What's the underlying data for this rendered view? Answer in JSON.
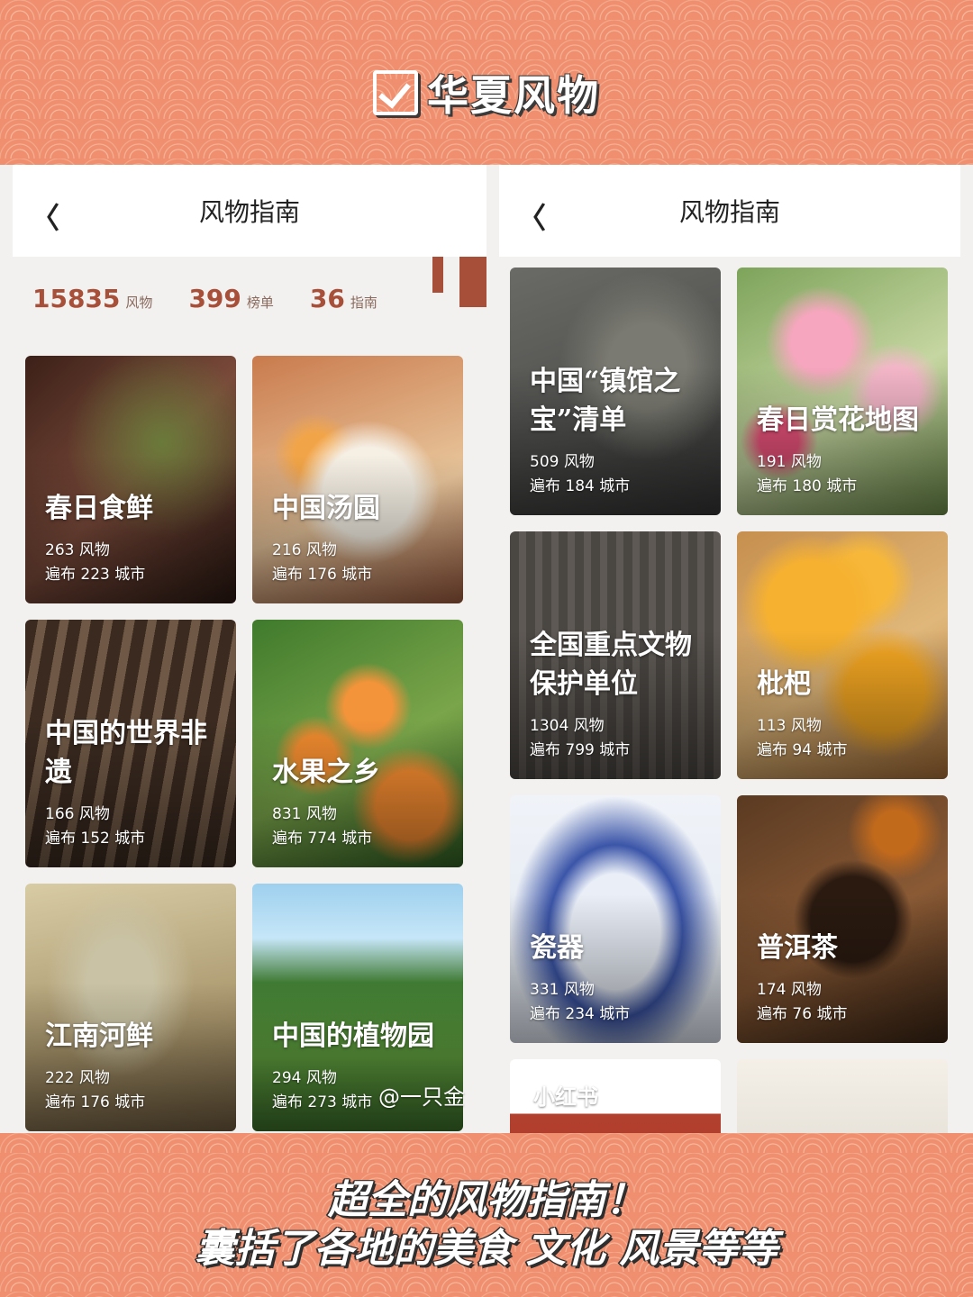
{
  "header": {
    "title": "华夏风物"
  },
  "left_screen": {
    "nav": {
      "back_label": "〈",
      "title": "风物指南"
    },
    "stats": [
      {
        "number": "15835",
        "unit": "风物"
      },
      {
        "number": "399",
        "unit": "榜单"
      },
      {
        "number": "36",
        "unit": "指南"
      }
    ],
    "cards": [
      {
        "title": "春日食鲜",
        "count": "263 风物",
        "cities": "遍布 223 城市"
      },
      {
        "title": "中国汤圆",
        "count": "216 风物",
        "cities": "遍布 176 城市"
      },
      {
        "title": "中国的世界非遗",
        "count": "166 风物",
        "cities": "遍布 152 城市"
      },
      {
        "title": "水果之乡",
        "count": "831 风物",
        "cities": "遍布 774 城市"
      },
      {
        "title": "江南河鲜",
        "count": "222 风物",
        "cities": "遍布 176 城市"
      },
      {
        "title": "中国的植物园",
        "count": "294 风物",
        "cities": "遍布 273 城市"
      }
    ]
  },
  "right_screen": {
    "nav": {
      "back_label": "〈",
      "title": "风物指南"
    },
    "cards": [
      {
        "title": "中国“镇馆之宝”清单",
        "count": "509 风物",
        "cities": "遍布 184 城市"
      },
      {
        "title": "春日赏花地图",
        "count": "191 风物",
        "cities": "遍布 180 城市"
      },
      {
        "title": "全国重点文物保护单位",
        "count": "1304 风物",
        "cities": "遍布 799 城市"
      },
      {
        "title": "枇杷",
        "count": "113 风物",
        "cities": "遍布 94 城市"
      },
      {
        "title": "瓷器",
        "count": "331 风物",
        "cities": "遍布 234 城市"
      },
      {
        "title": "普洱茶",
        "count": "174 风物",
        "cities": "遍布 76 城市"
      }
    ]
  },
  "watermark": {
    "platform": "小红书",
    "user": "@一只金"
  },
  "caption": {
    "line1": "超全的风物指南！",
    "line2": "囊括了各地的美食 文化 风景等等"
  }
}
